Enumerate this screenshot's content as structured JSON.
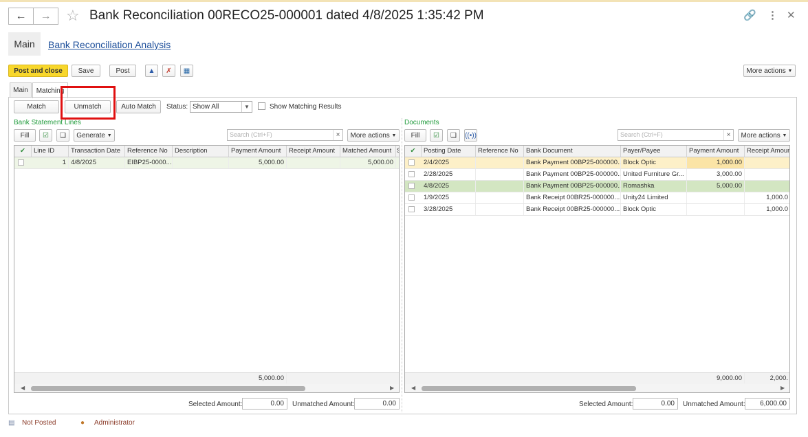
{
  "window": {
    "title": "Bank Reconciliation 00RECO25-000001 dated 4/8/2025 1:35:42 PM"
  },
  "top_tabs": {
    "main": "Main",
    "analysis_link": "Bank Reconciliation Analysis"
  },
  "toolbar": {
    "post_and_close": "Post and close",
    "save": "Save",
    "post": "Post",
    "more_actions": "More actions"
  },
  "inner_tabs": {
    "main": "Main",
    "matching": "Matching"
  },
  "matching": {
    "match": "Match",
    "unmatch": "Unmatch",
    "auto_match": "Auto Match",
    "status_label": "Status:",
    "status_value": "Show All",
    "show_results": "Show Matching Results"
  },
  "left": {
    "title": "Bank Statement Lines",
    "fill": "Fill",
    "generate": "Generate",
    "search_placeholder": "Search (Ctrl+F)",
    "more_actions": "More actions",
    "columns": [
      "Line ID",
      "Transaction Date",
      "Reference No",
      "Description",
      "Payment Amount",
      "Receipt Amount",
      "Matched Amount",
      "S"
    ],
    "rows": [
      {
        "line_id": "1",
        "date": "4/8/2025",
        "ref": "EIBP25-0000...",
        "desc": "",
        "payment": "5,000.00",
        "receipt": "",
        "matched": "5,000.00"
      }
    ],
    "total_payment": "5,000.00",
    "selected_amount_label": "Selected Amount:",
    "selected_amount": "0.00",
    "unmatched_amount_label": "Unmatched Amount:",
    "unmatched_amount": "0.00"
  },
  "right": {
    "title": "Documents",
    "fill": "Fill",
    "search_placeholder": "Search (Ctrl+F)",
    "more_actions": "More actions",
    "columns": [
      "Posting Date",
      "Reference No",
      "Bank Document",
      "Payer/Payee",
      "Payment Amount",
      "Receipt Amount"
    ],
    "rows": [
      {
        "date": "2/4/2025",
        "ref": "",
        "doc": "Bank Payment 00BP25-000000...",
        "payee": "Block Optic",
        "payment": "1,000.00",
        "receipt": ""
      },
      {
        "date": "2/28/2025",
        "ref": "",
        "doc": "Bank Payment 00BP25-000000...",
        "payee": "United Furniture Gr...",
        "payment": "3,000.00",
        "receipt": ""
      },
      {
        "date": "4/8/2025",
        "ref": "",
        "doc": "Bank Payment 00BP25-000000...",
        "payee": "Romashka",
        "payment": "5,000.00",
        "receipt": ""
      },
      {
        "date": "1/9/2025",
        "ref": "",
        "doc": "Bank Receipt 00BR25-000000...",
        "payee": "Unity24 Limited",
        "payment": "",
        "receipt": "1,000.0"
      },
      {
        "date": "3/28/2025",
        "ref": "",
        "doc": "Bank Receipt 00BR25-000000...",
        "payee": "Block Optic",
        "payment": "",
        "receipt": "1,000.0"
      }
    ],
    "total_payment": "9,000.00",
    "total_receipt": "2,000.",
    "selected_amount_label": "Selected Amount:",
    "selected_amount": "0.00",
    "unmatched_amount_label": "Unmatched Amount:",
    "unmatched_amount": "6,000.00"
  },
  "status_bar": {
    "status": "Not Posted",
    "user": "Administrator"
  },
  "colors": {
    "primary": "#f8d72c",
    "highlight_row": "#fdf0c8",
    "matched_row": "#d3e6c2",
    "section_title": "#1e9a3a",
    "link": "#1c4e9a"
  }
}
